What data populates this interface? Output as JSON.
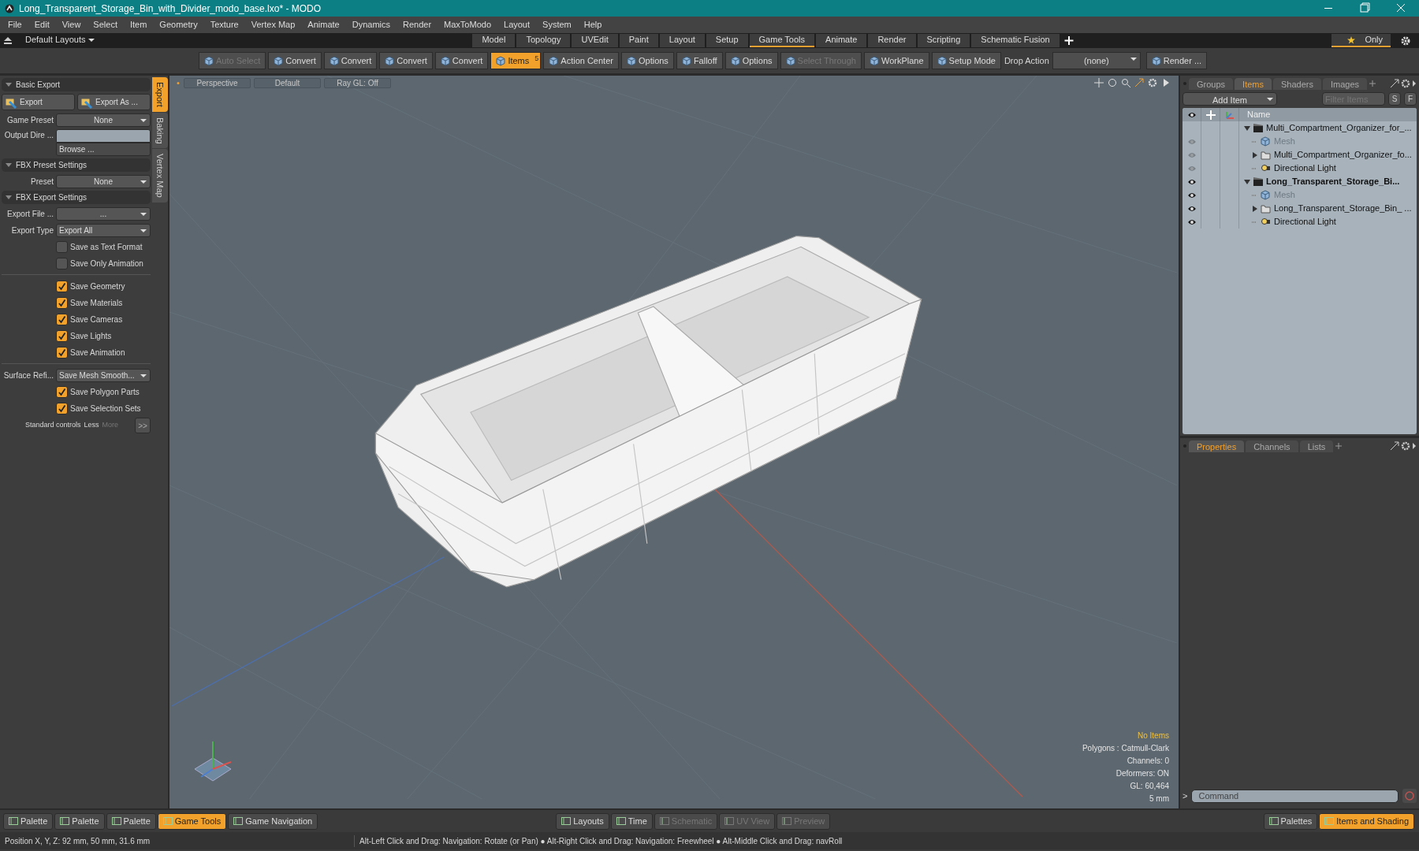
{
  "window": {
    "title": "Long_Transparent_Storage_Bin_with_Divider_modo_base.lxo* - MODO"
  },
  "menu": [
    "File",
    "Edit",
    "View",
    "Select",
    "Item",
    "Geometry",
    "Texture",
    "Vertex Map",
    "Animate",
    "Dynamics",
    "Render",
    "MaxToModo",
    "Layout",
    "System",
    "Help"
  ],
  "layout_bar": {
    "preset": "Default Layouts",
    "tabs": [
      {
        "label": "Model",
        "selected": false
      },
      {
        "label": "Topology",
        "selected": false
      },
      {
        "label": "UVEdit",
        "selected": false
      },
      {
        "label": "Paint",
        "selected": false
      },
      {
        "label": "Layout",
        "selected": false
      },
      {
        "label": "Setup",
        "selected": false
      },
      {
        "label": "Game Tools",
        "selected": true
      },
      {
        "label": "Animate",
        "selected": false
      },
      {
        "label": "Render",
        "selected": false
      },
      {
        "label": "Scripting",
        "selected": false
      },
      {
        "label": "Schematic Fusion",
        "selected": false
      }
    ],
    "only": "Only"
  },
  "toolbar": [
    {
      "kind": "button",
      "label": "Auto Select",
      "disabled": true,
      "selected": false
    },
    {
      "kind": "button",
      "label": "Convert",
      "disabled": false,
      "selected": false
    },
    {
      "kind": "button",
      "label": "Convert",
      "disabled": false,
      "selected": false
    },
    {
      "kind": "button",
      "label": "Convert",
      "disabled": false,
      "selected": false
    },
    {
      "kind": "button",
      "label": "Convert",
      "disabled": false,
      "selected": false
    },
    {
      "kind": "button",
      "label": "Items",
      "disabled": false,
      "selected": true,
      "badge": "5"
    },
    {
      "kind": "button",
      "label": "Action Center",
      "disabled": false,
      "selected": false
    },
    {
      "kind": "button",
      "label": "Options",
      "disabled": false,
      "selected": false
    },
    {
      "kind": "button",
      "label": "Falloff",
      "disabled": false,
      "selected": false
    },
    {
      "kind": "button",
      "label": "Options",
      "disabled": false,
      "selected": false
    },
    {
      "kind": "button",
      "label": "Select Through",
      "disabled": true,
      "selected": false
    },
    {
      "kind": "button",
      "label": "WorkPlane",
      "disabled": false,
      "selected": false
    },
    {
      "kind": "button",
      "label": "Setup Mode",
      "disabled": false,
      "selected": false
    },
    {
      "kind": "label",
      "label": "Drop Action"
    },
    {
      "kind": "dropdown",
      "label": "(none)"
    },
    {
      "kind": "button",
      "label": "Render ...",
      "disabled": false,
      "selected": false
    }
  ],
  "left_panel": {
    "tabs": [
      {
        "label": "Export",
        "selected": true
      },
      {
        "label": "Baking",
        "selected": false
      },
      {
        "label": "Vertex Map",
        "selected": false
      }
    ],
    "rows": [
      {
        "kind": "header",
        "label": "Basic Export"
      },
      {
        "kind": "buttons",
        "buttons": [
          "Export",
          "Export As ..."
        ]
      },
      {
        "kind": "select",
        "label": "Game Preset",
        "value": "None"
      },
      {
        "kind": "field",
        "label": "Output Dire ...",
        "button": "Browse ..."
      },
      {
        "kind": "header",
        "label": "FBX Preset Settings"
      },
      {
        "kind": "select",
        "label": "Preset",
        "value": "None"
      },
      {
        "kind": "header",
        "label": "FBX Export Settings"
      },
      {
        "kind": "select",
        "label": "Export File  ...",
        "value": "..."
      },
      {
        "kind": "select",
        "label": "Export Type",
        "value": "Export All"
      },
      {
        "kind": "checkbox",
        "label": "Save as Text Format",
        "checked": false
      },
      {
        "kind": "checkbox",
        "label": "Save Only Animation",
        "checked": false
      },
      {
        "kind": "divider"
      },
      {
        "kind": "checkbox",
        "label": "Save Geometry",
        "checked": true
      },
      {
        "kind": "checkbox",
        "label": "Save Materials",
        "checked": true
      },
      {
        "kind": "checkbox",
        "label": "Save Cameras",
        "checked": true
      },
      {
        "kind": "checkbox",
        "label": "Save Lights",
        "checked": true
      },
      {
        "kind": "checkbox",
        "label": "Save Animation",
        "checked": true
      },
      {
        "kind": "divider"
      },
      {
        "kind": "select",
        "label": "Surface Refi...",
        "value": "Save Mesh Smooth..."
      },
      {
        "kind": "checkbox",
        "label": "Save Polygon Parts",
        "checked": true
      },
      {
        "kind": "checkbox",
        "label": "Save Selection Sets",
        "checked": true
      },
      {
        "kind": "footer",
        "label": "Standard controls",
        "less": "Less",
        "more": "More",
        "button": ">>"
      }
    ]
  },
  "viewport": {
    "header": [
      "Perspective",
      "Default",
      "Ray GL: Off"
    ],
    "info": [
      {
        "text": "No Items",
        "highlight": true
      },
      {
        "text": "Polygons : Catmull-Clark",
        "highlight": false
      },
      {
        "text": "Channels: 0",
        "highlight": false
      },
      {
        "text": "Deformers: ON",
        "highlight": false
      },
      {
        "text": "GL: 60,464",
        "highlight": false
      },
      {
        "text": "5 mm",
        "highlight": false
      }
    ]
  },
  "items_panel": {
    "tabs": [
      {
        "label": "Groups",
        "selected": false
      },
      {
        "label": "Items",
        "selected": true
      },
      {
        "label": "Shaders",
        "selected": false
      },
      {
        "label": "Images",
        "selected": false
      }
    ],
    "add_item": "Add Item",
    "filter": {
      "placeholder": "Filter Items"
    },
    "filter_buttons": [
      "S",
      "F"
    ],
    "column": "Name",
    "tree": [
      {
        "kind": "scene",
        "name": "Multi_Compartment_Organizer_for_...",
        "current": false,
        "expanded": true,
        "children": [
          {
            "kind": "mesh",
            "name": "Mesh",
            "visible": false
          },
          {
            "kind": "group",
            "name": "Multi_Compartment_Organizer_fo...",
            "visible": false,
            "expanded": false
          },
          {
            "kind": "light",
            "name": "Directional Light",
            "visible": false
          }
        ]
      },
      {
        "kind": "scene",
        "name": "Long_Transparent_Storage_Bi...",
        "current": true,
        "visible": true,
        "expanded": true,
        "children": [
          {
            "kind": "mesh",
            "name": "Mesh",
            "visible": true
          },
          {
            "kind": "group",
            "name": "Long_Transparent_Storage_Bin_ ...",
            "visible": true,
            "expanded": false
          },
          {
            "kind": "light",
            "name": "Directional Light",
            "visible": true
          }
        ]
      }
    ]
  },
  "properties_panel": {
    "tabs": [
      {
        "label": "Properties",
        "selected": true
      },
      {
        "label": "Channels",
        "selected": false
      },
      {
        "label": "Lists",
        "selected": false
      }
    ],
    "prompt": ">",
    "command_placeholder": "Command"
  },
  "bottom_bar": {
    "left": [
      {
        "label": "Palette",
        "selected": false,
        "disabled": false
      },
      {
        "label": "Palette",
        "selected": false,
        "disabled": false
      },
      {
        "label": "Palette",
        "selected": false,
        "disabled": false
      },
      {
        "label": "Game Tools",
        "selected": true,
        "disabled": false
      },
      {
        "label": "Game Navigation",
        "selected": false,
        "disabled": false
      }
    ],
    "center": [
      {
        "label": "Layouts",
        "selected": false,
        "disabled": false
      },
      {
        "label": "Time",
        "selected": false,
        "disabled": false
      },
      {
        "label": "Schematic",
        "selected": false,
        "disabled": true
      },
      {
        "label": "UV View",
        "selected": false,
        "disabled": true
      },
      {
        "label": "Preview",
        "selected": false,
        "disabled": true
      }
    ],
    "right": [
      {
        "label": "Palettes",
        "selected": false,
        "disabled": false
      },
      {
        "label": "Items and Shading",
        "selected": true,
        "disabled": false
      }
    ]
  },
  "status_bar": {
    "position": "Position X, Y, Z:  92 mm, 50 mm, 31.6 mm",
    "hint": "Alt-Left Click and Drag: Navigation: Rotate (or Pan) ● Alt-Right Click and Drag: Navigation: Freewheel ● Alt-Middle Click and Drag: navRoll"
  }
}
